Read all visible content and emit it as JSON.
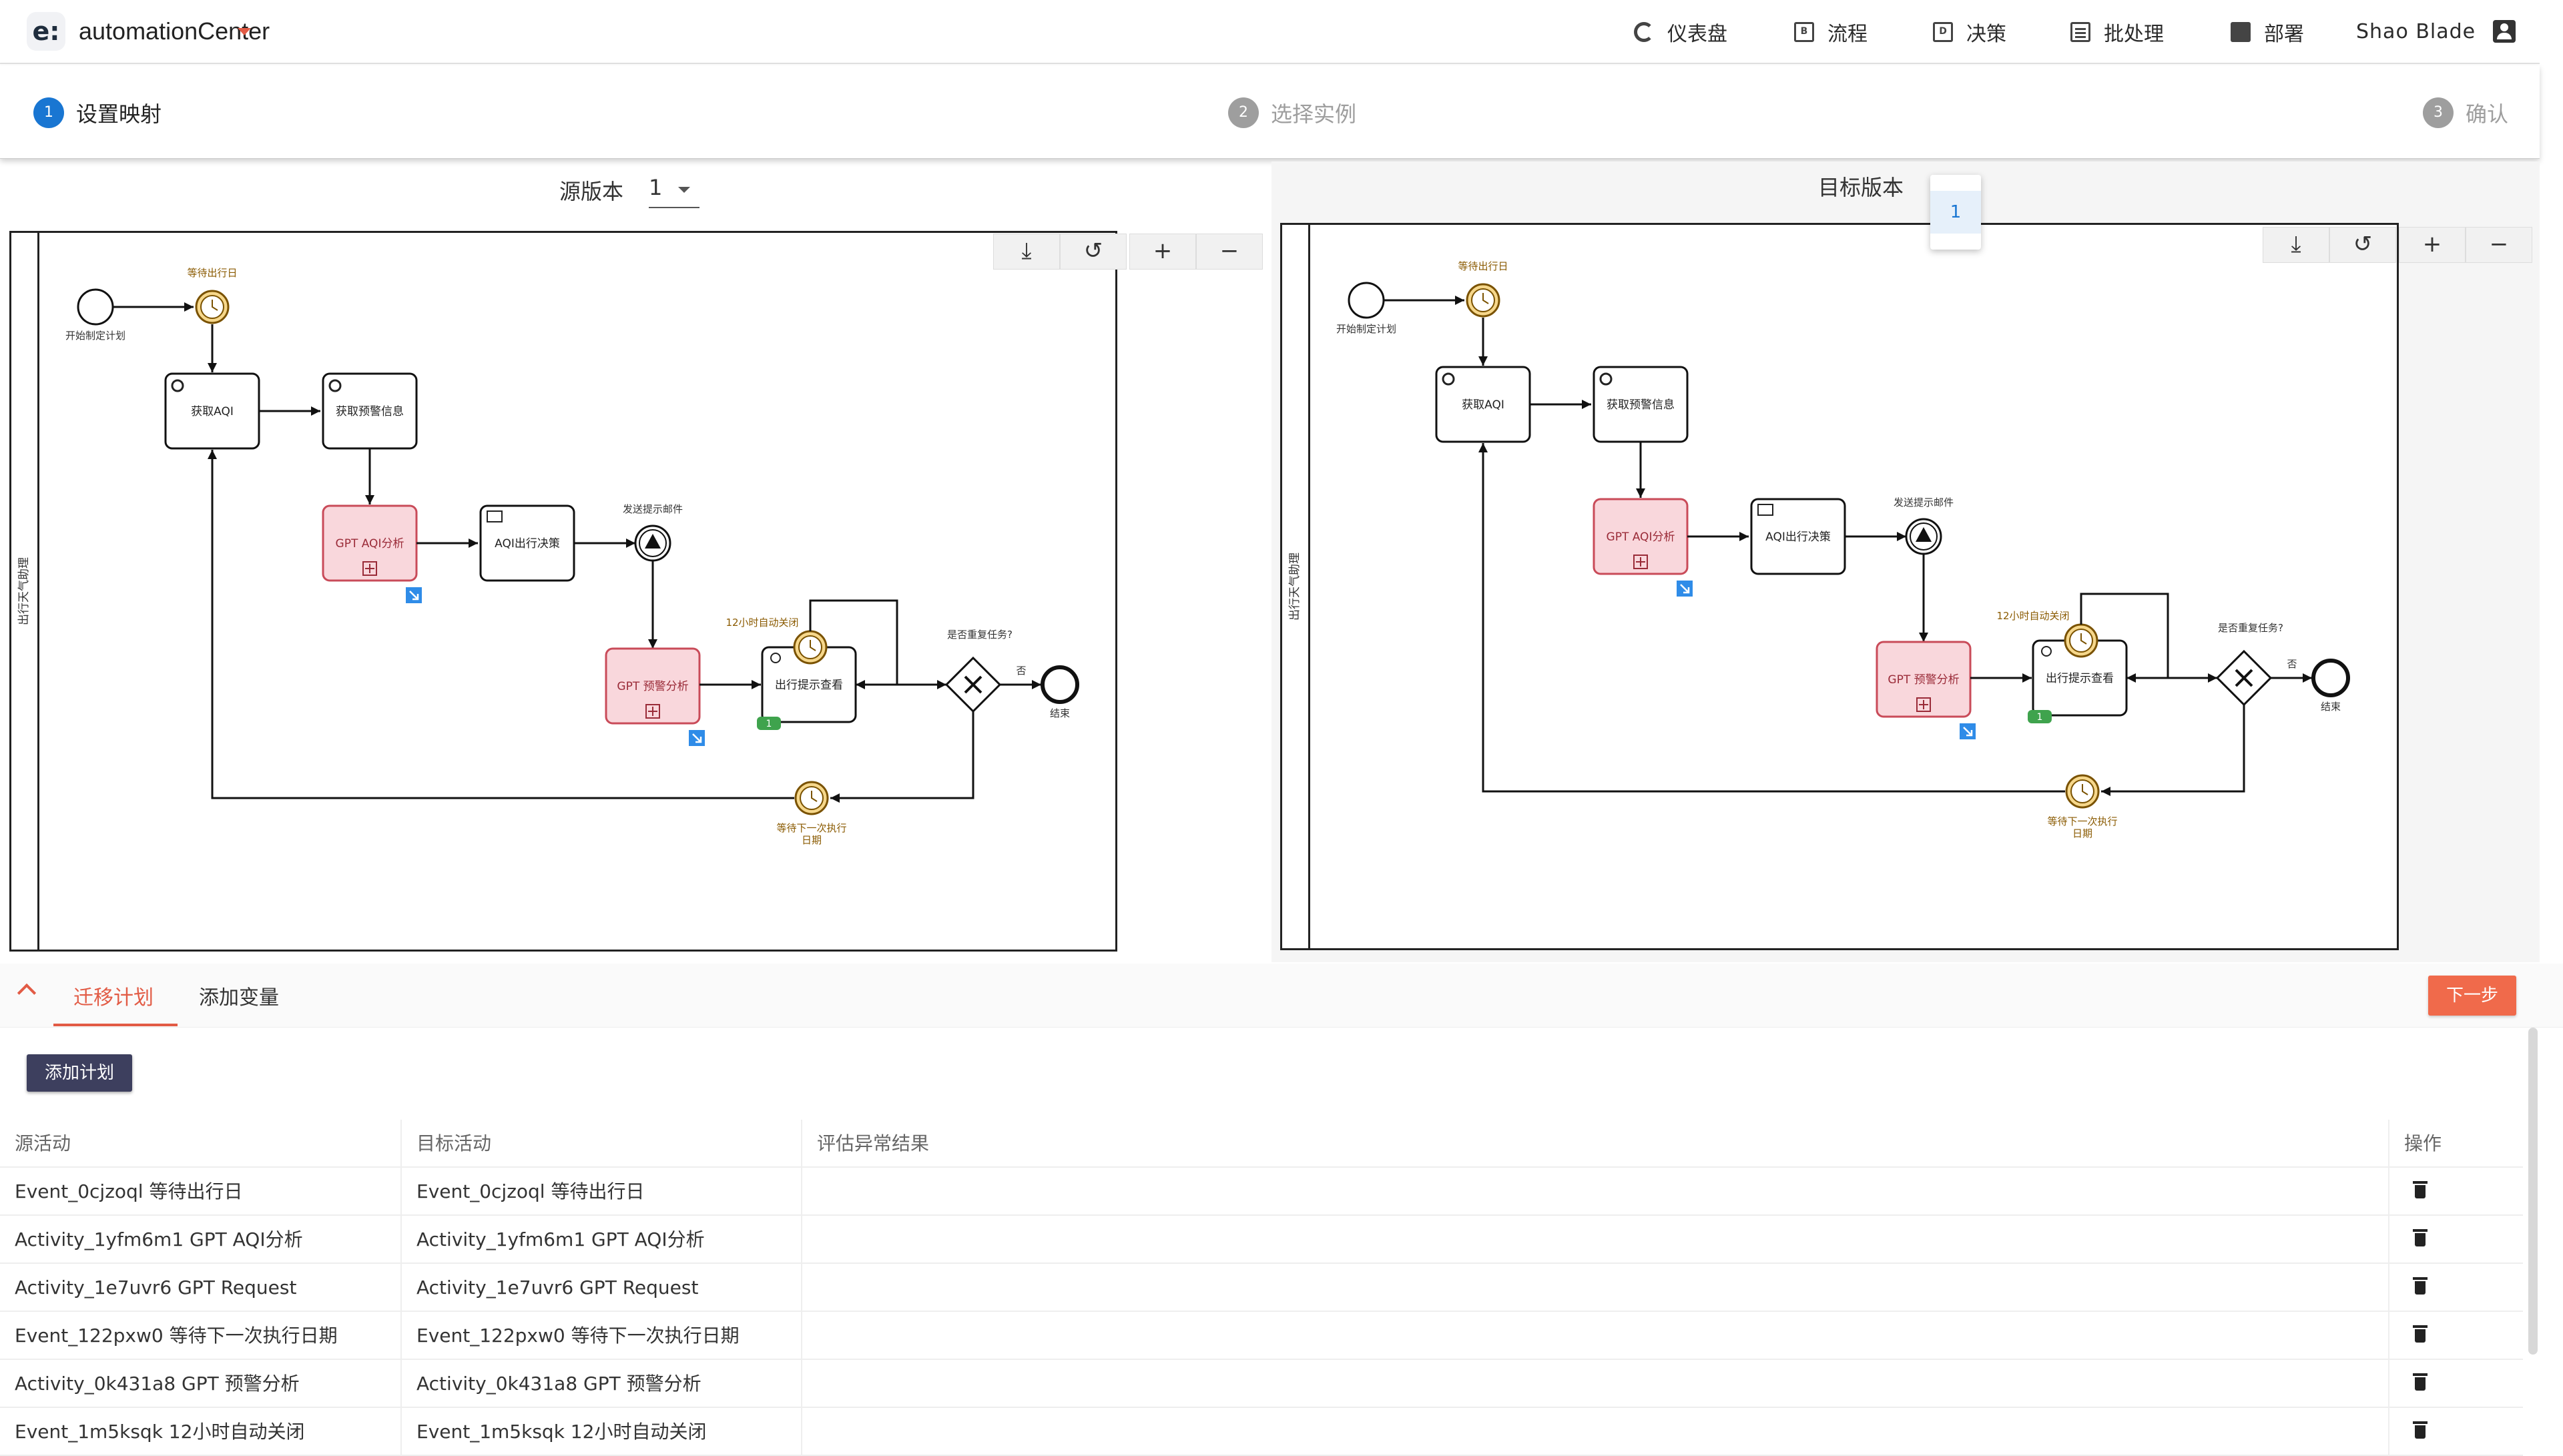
{
  "header": {
    "logo_glyph": "e:",
    "app_name": "automationCenter",
    "nav": [
      {
        "label": "仪表盘",
        "icon": "dashboard-icon"
      },
      {
        "label": "流程",
        "icon": "process-icon"
      },
      {
        "label": "决策",
        "icon": "decision-icon"
      },
      {
        "label": "批处理",
        "icon": "batch-icon"
      },
      {
        "label": "部署",
        "icon": "deploy-icon"
      }
    ],
    "user_name": "Shao Blade"
  },
  "stepper": [
    {
      "num": "1",
      "label": "设置映射",
      "state": "active"
    },
    {
      "num": "2",
      "label": "选择实例",
      "state": "inactive"
    },
    {
      "num": "3",
      "label": "确认",
      "state": "inactive"
    }
  ],
  "source": {
    "title": "源版本",
    "selected": "1"
  },
  "target": {
    "title": "目标版本",
    "options": [
      "1"
    ]
  },
  "diagram": {
    "lane": "出行天气助理",
    "start": "开始制定计划",
    "timer1": "等待出行日",
    "task_aqi": "获取AQI",
    "task_warn": "获取预警信息",
    "task_gpt_aqi": "GPT AQI分析",
    "task_aqi_decision": "AQI出行决策",
    "event_mail": "发送提示邮件",
    "task_gpt_warn": "GPT 预警分析",
    "task_view": "出行提示查看",
    "timer_close": "12小时自动关闭",
    "gateway": "是否重复任务?",
    "gateway_no": "否",
    "end": "结束",
    "timer_next_1": "等待下一次执行",
    "timer_next_2": "日期",
    "badge_count": "1"
  },
  "tabs": [
    {
      "label": "迁移计划",
      "active": true
    },
    {
      "label": "添加变量",
      "active": false
    }
  ],
  "next_button": "下一步",
  "add_plan_button": "添加计划",
  "table": {
    "headers": [
      "源活动",
      "目标活动",
      "评估异常结果",
      "操作"
    ],
    "rows": [
      [
        "Event_0cjzoql 等待出行日",
        "Event_0cjzoql 等待出行日",
        ""
      ],
      [
        "Activity_1yfm6m1 GPT AQI分析",
        "Activity_1yfm6m1 GPT AQI分析",
        ""
      ],
      [
        "Activity_1e7uvr6 GPT Request",
        "Activity_1e7uvr6 GPT Request",
        ""
      ],
      [
        "Event_122pxw0 等待下一次执行日期",
        "Event_122pxw0 等待下一次执行日期",
        ""
      ],
      [
        "Activity_0k431a8 GPT 预警分析",
        "Activity_0k431a8 GPT 预警分析",
        ""
      ],
      [
        "Event_1m5ksqk 12小时自动关闭",
        "Event_1m5ksqk 12小时自动关闭",
        ""
      ]
    ]
  },
  "colors": {
    "accent": "#e25b45",
    "primary": "#1976d2",
    "gpt_task_fill": "#f9d7dc",
    "gpt_task_stroke": "#c94b59",
    "timer_fill": "#f6d78b"
  }
}
